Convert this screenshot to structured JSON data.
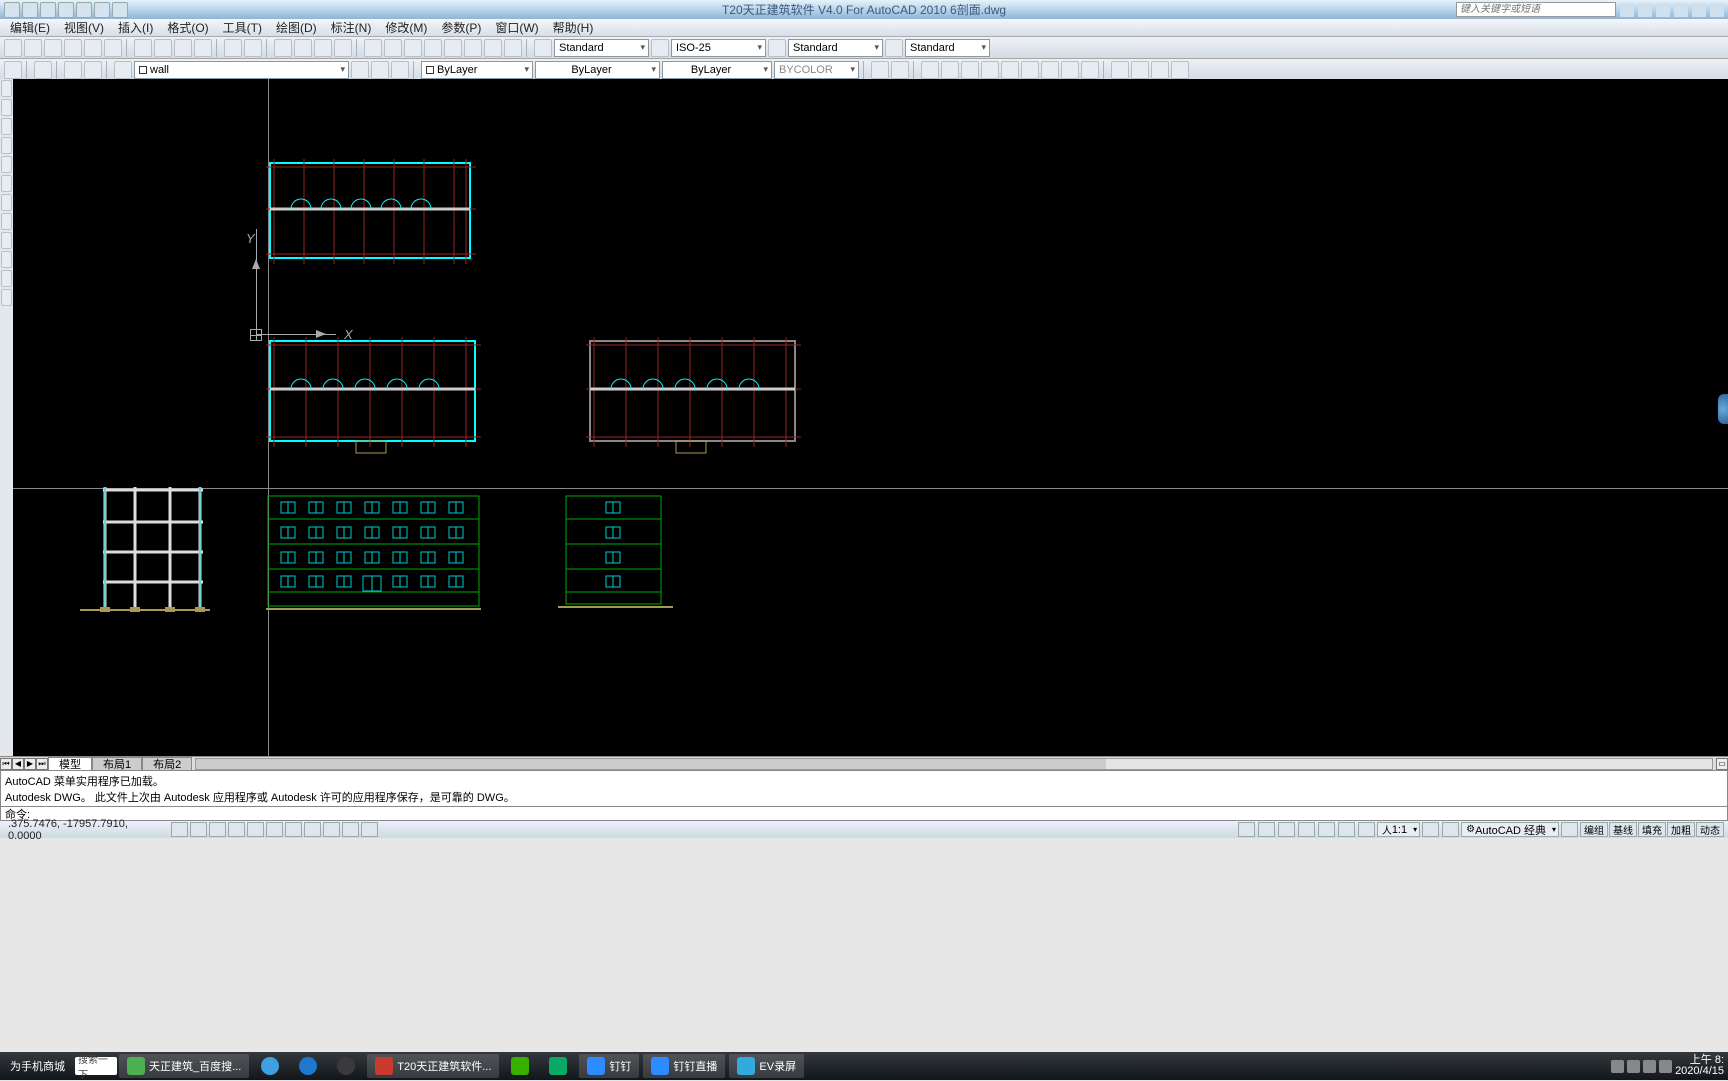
{
  "title": "T20天正建筑软件 V4.0 For AutoCAD 2010      6剖面.dwg",
  "search_placeholder": "键入关键字或短语",
  "menu": [
    "编辑(E)",
    "视图(V)",
    "插入(I)",
    "格式(O)",
    "工具(T)",
    "绘图(D)",
    "标注(N)",
    "修改(M)",
    "参数(P)",
    "窗口(W)",
    "帮助(H)"
  ],
  "styles": {
    "text": "Standard",
    "dim": "ISO-25",
    "table": "Standard",
    "ml": "Standard"
  },
  "layer": {
    "current": "wall",
    "color": "ByLayer",
    "linetype": "ByLayer",
    "lineweight": "ByLayer",
    "plotstyle": "BYCOLOR"
  },
  "tabs": {
    "model": "模型",
    "layout1": "布局1",
    "layout2": "布局2"
  },
  "cmd": {
    "line1": "AutoCAD 菜单实用程序已加载。",
    "line2": "Autodesk DWG。  此文件上次由 Autodesk 应用程序或 Autodesk 许可的应用程序保存，是可靠的 DWG。",
    "prompt": "命令:"
  },
  "status": {
    "coords": ".375.7476,  -17957.7910, 0.0000",
    "scale": "1:1",
    "ws": "AutoCAD 经典",
    "toggles": [
      "编组",
      "基线",
      "填充",
      "加粗",
      "动态"
    ]
  },
  "taskbar": {
    "left": "为手机商城",
    "search": "搜索一下",
    "items": [
      {
        "label": "天正建筑_百度搜...",
        "color": "#4caf50"
      },
      {
        "label": "",
        "color": "#3ea0e0"
      },
      {
        "label": "",
        "color": "#1f78d0"
      },
      {
        "label": "",
        "color": "#3a3a3a"
      },
      {
        "label": "T20天正建筑软件...",
        "color": "#c93a2e"
      },
      {
        "label": "",
        "color": "#38b000"
      },
      {
        "label": "",
        "color": "#09aa66"
      },
      {
        "label": "钉钉",
        "color": "#2a8cff"
      },
      {
        "label": "钉钉直播",
        "color": "#2a8cff"
      },
      {
        "label": "EV录屏",
        "color": "#3ad"
      }
    ],
    "time": "上午 8:",
    "date": "2020/4/15"
  },
  "ucs": {
    "x": "X",
    "y": "Y"
  }
}
